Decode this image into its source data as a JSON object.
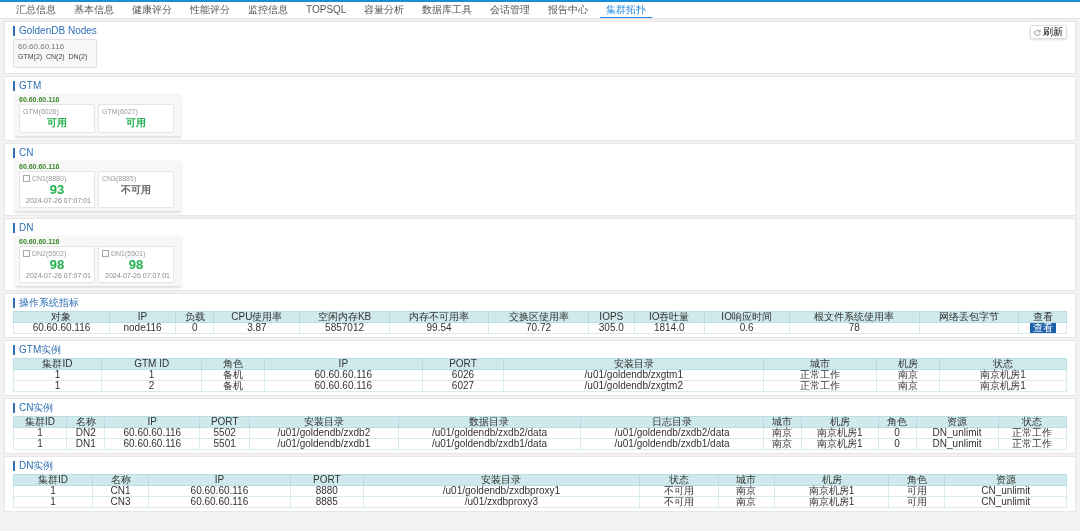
{
  "tabs": [
    {
      "label": "汇总信息",
      "selected": false
    },
    {
      "label": "基本信息",
      "selected": false
    },
    {
      "label": "健康评分",
      "selected": false
    },
    {
      "label": "性能评分",
      "selected": false
    },
    {
      "label": "监控信息",
      "selected": false
    },
    {
      "label": "TOPSQL",
      "selected": false
    },
    {
      "label": "容量分析",
      "selected": false
    },
    {
      "label": "数据库工具",
      "selected": false
    },
    {
      "label": "会话管理",
      "selected": false
    },
    {
      "label": "报告中心",
      "selected": false
    },
    {
      "label": "集群拓扑",
      "selected": true
    }
  ],
  "nodes": {
    "title": "GoldenDB Nodes",
    "refresh": "刷新",
    "cards": [
      {
        "host": "60.60.60.116",
        "summary": "GTM(2)  CN(2)  DN(2)"
      }
    ]
  },
  "groups": [
    {
      "title": "GTM",
      "host": "60.60.60.116",
      "items": [
        {
          "kind": "status",
          "label": "GTM(6026)",
          "value": "可用",
          "available": true
        },
        {
          "kind": "status",
          "label": "GTM(6027)",
          "value": "可用",
          "available": true
        }
      ]
    },
    {
      "title": "CN",
      "host": "60.60.60.116",
      "items": [
        {
          "kind": "score",
          "label": "CN1(8880)",
          "value": "93",
          "available": true,
          "time": "2024-07-26 07:07:01"
        },
        {
          "kind": "status",
          "label": "CN3(8885)",
          "value": "不可用",
          "available": false
        }
      ]
    },
    {
      "title": "DN",
      "host": "60.60.60.116",
      "items": [
        {
          "kind": "score",
          "label": "DN2(5502)",
          "value": "98",
          "available": true,
          "time": "2024-07-26 07:07:01"
        },
        {
          "kind": "score",
          "label": "DN1(5501)",
          "value": "98",
          "available": true,
          "time": "2024-07-26 07:07:01"
        }
      ]
    }
  ],
  "os_metrics": {
    "title": "操作系统指标",
    "columns": [
      "对象",
      "IP",
      "负载",
      "CPU使用率",
      "空闲内存KB",
      "内存不可用率",
      "交换区使用率",
      "IOPS",
      "IO吞吐量",
      "IO响应时间",
      "根文件系统使用率",
      "网络丢包字节",
      "查看"
    ],
    "rows": [
      {
        "cells": [
          "60.60.60.116",
          "node116",
          "0",
          "3.87",
          "5857012",
          "99.54",
          "70.72",
          "305.0",
          "1814.0",
          "0.6",
          "78"
        ],
        "action": "查看"
      }
    ]
  },
  "tables": [
    {
      "title": "GTM实例",
      "columns": [
        "集群ID",
        "GTM ID",
        "角色",
        "IP",
        "PORT",
        "安装目录",
        "城市",
        "机房",
        "状态"
      ],
      "rows": [
        [
          "1",
          "1",
          "备机",
          "60.60.60.116",
          "6026",
          "/u01/goldendb/zxgtm1",
          "正常工作",
          "南京",
          "南京机房1"
        ],
        [
          "1",
          "2",
          "备机",
          "60.60.60.116",
          "6027",
          "/u01/goldendb/zxgtm2",
          "正常工作",
          "南京",
          "南京机房1"
        ]
      ]
    },
    {
      "title": "CN实例",
      "columns": [
        "集群ID",
        "名称",
        "IP",
        "PORT",
        "安装目录",
        "数据目录",
        "日志目录",
        "城市",
        "机房",
        "角色",
        "资源",
        "状态"
      ],
      "rows": [
        [
          "1",
          "DN2",
          "60.60.60.116",
          "5502",
          "/u01/goldendb/zxdb2",
          "/u01/goldendb/zxdb2/data",
          "/u01/goldendb/zxdb2/data",
          "南京",
          "南京机房1",
          "0",
          "DN_unlimit",
          "正常工作"
        ],
        [
          "1",
          "DN1",
          "60.60.60.116",
          "5501",
          "/u01/goldendb/zxdb1",
          "/u01/goldendb/zxdb1/data",
          "/u01/goldendb/zxdb1/data",
          "南京",
          "南京机房1",
          "0",
          "DN_unlimit",
          "正常工作"
        ]
      ]
    },
    {
      "title": "DN实例",
      "columns": [
        "集群ID",
        "名称",
        "IP",
        "PORT",
        "安装目录",
        "状态",
        "城市",
        "机房",
        "角色",
        "资源"
      ],
      "rows": [
        [
          "1",
          "CN1",
          "60.60.60.116",
          "8880",
          "/u01/goldendb/zxdbproxy1",
          "不可用",
          "南京",
          "南京机房1",
          "可用",
          "CN_unlimit"
        ],
        [
          "1",
          "CN3",
          "60.60.60.116",
          "8885",
          "/u01/zxdbproxy3",
          "不可用",
          "南京",
          "南京机房1",
          "可用",
          "CN_unlimit"
        ]
      ]
    }
  ]
}
